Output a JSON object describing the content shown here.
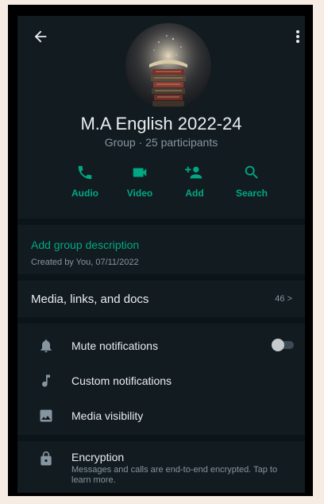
{
  "header": {
    "title": "M.A English 2022-24",
    "subtitle": "Group · 25 participants",
    "actions": [
      {
        "label": "Audio",
        "icon": "phone-icon"
      },
      {
        "label": "Video",
        "icon": "video-icon"
      },
      {
        "label": "Add",
        "icon": "add-person-icon"
      },
      {
        "label": "Search",
        "icon": "search-icon"
      }
    ]
  },
  "description": {
    "link": "Add group description",
    "created": "Created by You, 07/11/2022"
  },
  "media": {
    "title": "Media, links, and docs",
    "count": "46 >"
  },
  "settings": [
    {
      "label": "Mute notifications",
      "icon": "bell-icon",
      "toggle_on": false
    },
    {
      "label": "Custom notifications",
      "icon": "music-note-icon"
    },
    {
      "label": "Media visibility",
      "icon": "image-icon"
    }
  ],
  "encryption": {
    "title": "Encryption",
    "subtitle": "Messages and calls are end-to-end encrypted. Tap to learn more."
  },
  "colors": {
    "accent": "#00a884",
    "background": "#121b20",
    "separator": "#0b1418",
    "text_primary": "#e9edef",
    "text_secondary": "#8696a0",
    "page_border": "#f6ece3"
  }
}
